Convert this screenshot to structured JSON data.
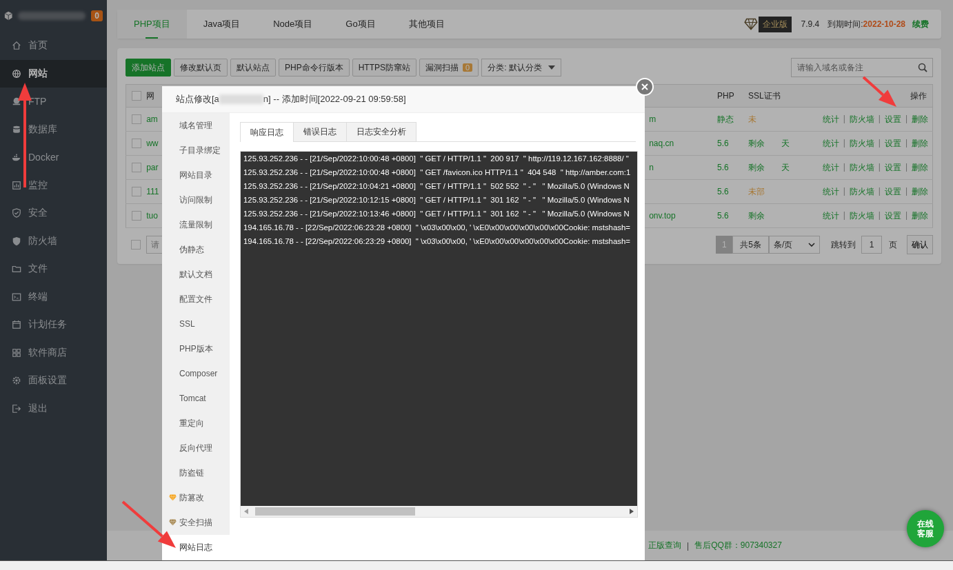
{
  "sidebar": {
    "badge": "0",
    "items": [
      {
        "label": "首页",
        "selected": false
      },
      {
        "label": "网站",
        "selected": true
      },
      {
        "label": "FTP",
        "selected": false
      },
      {
        "label": "数据库",
        "selected": false
      },
      {
        "label": "Docker",
        "selected": false
      },
      {
        "label": "监控",
        "selected": false
      },
      {
        "label": "安全",
        "selected": false
      },
      {
        "label": "防火墙",
        "selected": false
      },
      {
        "label": "文件",
        "selected": false
      },
      {
        "label": "终端",
        "selected": false
      },
      {
        "label": "计划任务",
        "selected": false
      },
      {
        "label": "软件商店",
        "selected": false
      },
      {
        "label": "面板设置",
        "selected": false
      },
      {
        "label": "退出",
        "selected": false
      }
    ]
  },
  "project_tabs": [
    {
      "label": "PHP项目",
      "selected": true
    },
    {
      "label": "Java项目",
      "selected": false
    },
    {
      "label": "Node项目",
      "selected": false
    },
    {
      "label": "Go项目",
      "selected": false
    },
    {
      "label": "其他项目",
      "selected": false
    }
  ],
  "edition": {
    "badge": "企业版",
    "version": "7.9.4",
    "expiry_label": "到期时间:",
    "expiry_date": "2022-10-28",
    "renew": "续费"
  },
  "toolbar": {
    "buttons": [
      {
        "label": "添加站点",
        "kind": "primary"
      },
      {
        "label": "修改默认页",
        "kind": "plain"
      },
      {
        "label": "默认站点",
        "kind": "plain"
      },
      {
        "label": "PHP命令行版本",
        "kind": "plain"
      },
      {
        "label": "HTTPS防窜站",
        "kind": "plain"
      },
      {
        "label": "漏洞扫描",
        "kind": "plain",
        "count": "0"
      }
    ],
    "category": "分类: 默认分类",
    "search_placeholder": "请输入域名或备注"
  },
  "table": {
    "header_checked": false,
    "batch_checked": false,
    "action_separator": "|",
    "columns": [
      "网",
      "PHP",
      "SSL证书",
      "操作"
    ],
    "rows": [
      {
        "checked": false,
        "name_start": "am",
        "name_end": "m",
        "php": "静态",
        "ssl": "未",
        "warning": true,
        "actions": [
          "统计",
          "防火墙",
          "设置",
          "删除"
        ]
      },
      {
        "checked": false,
        "name_start": "ww",
        "name_end": "naq.cn",
        "php": "5.6",
        "ssl": "剩余",
        "ssl_end": "天",
        "warning": false,
        "actions": [
          "统计",
          "防火墙",
          "设置",
          "删除"
        ]
      },
      {
        "checked": false,
        "name_start": "par",
        "name_end": "n",
        "php": "5.6",
        "ssl": "剩余",
        "ssl_end": "天",
        "warning": false,
        "actions": [
          "统计",
          "防火墙",
          "设置",
          "删除"
        ]
      },
      {
        "checked": false,
        "name_start": "111",
        "php": "5.6",
        "ssl": "未部",
        "warning": true,
        "actions": [
          "统计",
          "防火墙",
          "设置",
          "删除"
        ]
      },
      {
        "checked": false,
        "name_start": "tuo",
        "name_end": "onv.top",
        "php": "5.6",
        "ssl": "剩余",
        "warning": false,
        "actions": [
          "统计",
          "防火墙",
          "设置",
          "删除"
        ]
      }
    ],
    "batch_placeholder": "请",
    "pagination": {
      "page": "1",
      "total": "共5条",
      "per_page": "条/页",
      "goto_label": "跳转到",
      "goto_value": "1",
      "page_unit": "页",
      "confirm": "确认"
    }
  },
  "footer": {
    "link": "正版查询",
    "separator": "|",
    "qq": "售后QQ群：907340327"
  },
  "chat_button": {
    "line1": "在线",
    "line2": "客服"
  },
  "dialog": {
    "title_start": "站点修改[a",
    "title_end": "n] -- 添加时间[2022-09-21 09:59:58]",
    "nav": [
      {
        "label": "域名管理",
        "selected": false,
        "kind": "plain"
      },
      {
        "label": "子目录绑定",
        "selected": false,
        "kind": "plain"
      },
      {
        "label": "网站目录",
        "selected": false,
        "kind": "plain"
      },
      {
        "label": "访问限制",
        "selected": false,
        "kind": "plain"
      },
      {
        "label": "流量限制",
        "selected": false,
        "kind": "plain"
      },
      {
        "label": "伪静态",
        "selected": false,
        "kind": "plain"
      },
      {
        "label": "默认文档",
        "selected": false,
        "kind": "plain"
      },
      {
        "label": "配置文件",
        "selected": false,
        "kind": "plain"
      },
      {
        "label": "SSL",
        "selected": false,
        "kind": "plain"
      },
      {
        "label": "PHP版本",
        "selected": false,
        "kind": "plain"
      },
      {
        "label": "Composer",
        "selected": false,
        "kind": "plain"
      },
      {
        "label": "Tomcat",
        "selected": false,
        "kind": "plain"
      },
      {
        "label": "重定向",
        "selected": false,
        "kind": "plain"
      },
      {
        "label": "反向代理",
        "selected": false,
        "kind": "plain"
      },
      {
        "label": "防盗链",
        "selected": false,
        "kind": "plain"
      },
      {
        "label": "防篡改",
        "selected": false,
        "kind": "gold"
      },
      {
        "label": "安全扫描",
        "selected": false,
        "kind": "bronze"
      },
      {
        "label": "网站日志",
        "selected": true,
        "kind": "plain"
      }
    ],
    "tabs": [
      {
        "label": "响应日志",
        "selected": true
      },
      {
        "label": "错误日志",
        "selected": false
      },
      {
        "label": "日志安全分析",
        "selected": false
      }
    ],
    "log_lines": [
      "125.93.252.236 - - [21/Sep/2022:10:00:48 +0800]  \" GET / HTTP/1.1 \"  200 917  \" http://119.12.167.162:8888/ \"",
      "125.93.252.236 - - [21/Sep/2022:10:00:48 +0800]  \" GET /favicon.ico HTTP/1.1 \"  404 548  \" http://amber.com:1",
      "125.93.252.236 - - [21/Sep/2022:10:04:21 +0800]  \" GET / HTTP/1.1 \"  502 552  \" - \"   \" Mozilla/5.0 (Windows N",
      "125.93.252.236 - - [21/Sep/2022:10:12:15 +0800]  \" GET / HTTP/1.1 \"  301 162  \" - \"   \" Mozilla/5.0 (Windows N",
      "125.93.252.236 - - [21/Sep/2022:10:13:46 +0800]  \" GET / HTTP/1.1 \"  301 162  \" - \"   \" Mozilla/5.0 (Windows N",
      "194.165.16.78 - - [22/Sep/2022:06:23:28 +0800]  \" \\x03\\x00\\x00, ' \\xE0\\x00\\x00\\x00\\x00\\x00Cookie: mstshash=",
      "194.165.16.78 - - [22/Sep/2022:06:23:29 +0800]  \" \\x03\\x00\\x00, ' \\xE0\\x00\\x00\\x00\\x00\\x00Cookie: mstshash="
    ]
  }
}
